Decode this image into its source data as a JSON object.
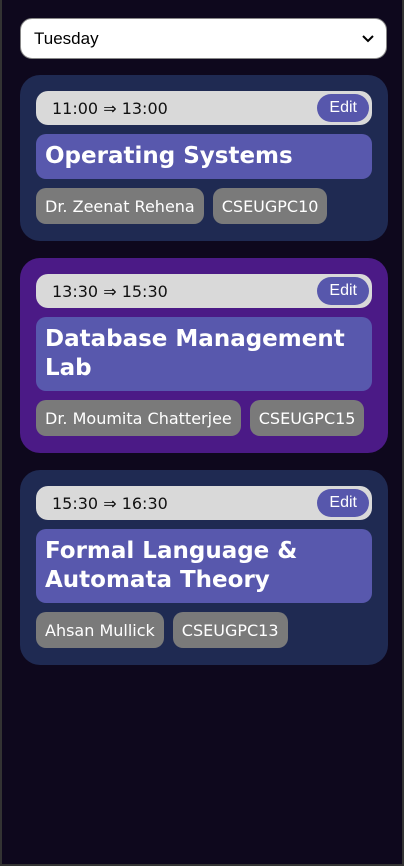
{
  "day_select": {
    "value": "Tuesday",
    "chevron_icon": "chevron-down-icon"
  },
  "classes": [
    {
      "time": "11:00 ⇒ 13:00",
      "edit_label": "Edit",
      "title": "Operating Systems",
      "teacher": "Dr. Zeenat Rehena",
      "code": "CSEUGPC10",
      "color": "#1f2a52"
    },
    {
      "time": "13:30 ⇒ 15:30",
      "edit_label": "Edit",
      "title": "Database Management Lab",
      "teacher": "Dr. Moumita Chatterjee",
      "code": "CSEUGPC15",
      "color": "#4b1a86"
    },
    {
      "time": "15:30 ⇒ 16:30",
      "edit_label": "Edit",
      "title": "Formal Language & Automata Theory",
      "teacher": "Ahsan Mullick",
      "code": "CSEUGPC13",
      "color": "#1f2a52"
    }
  ],
  "colors": {
    "background": "#0e081d",
    "accent": "#5858ad",
    "tag": "#7a7a7a"
  }
}
